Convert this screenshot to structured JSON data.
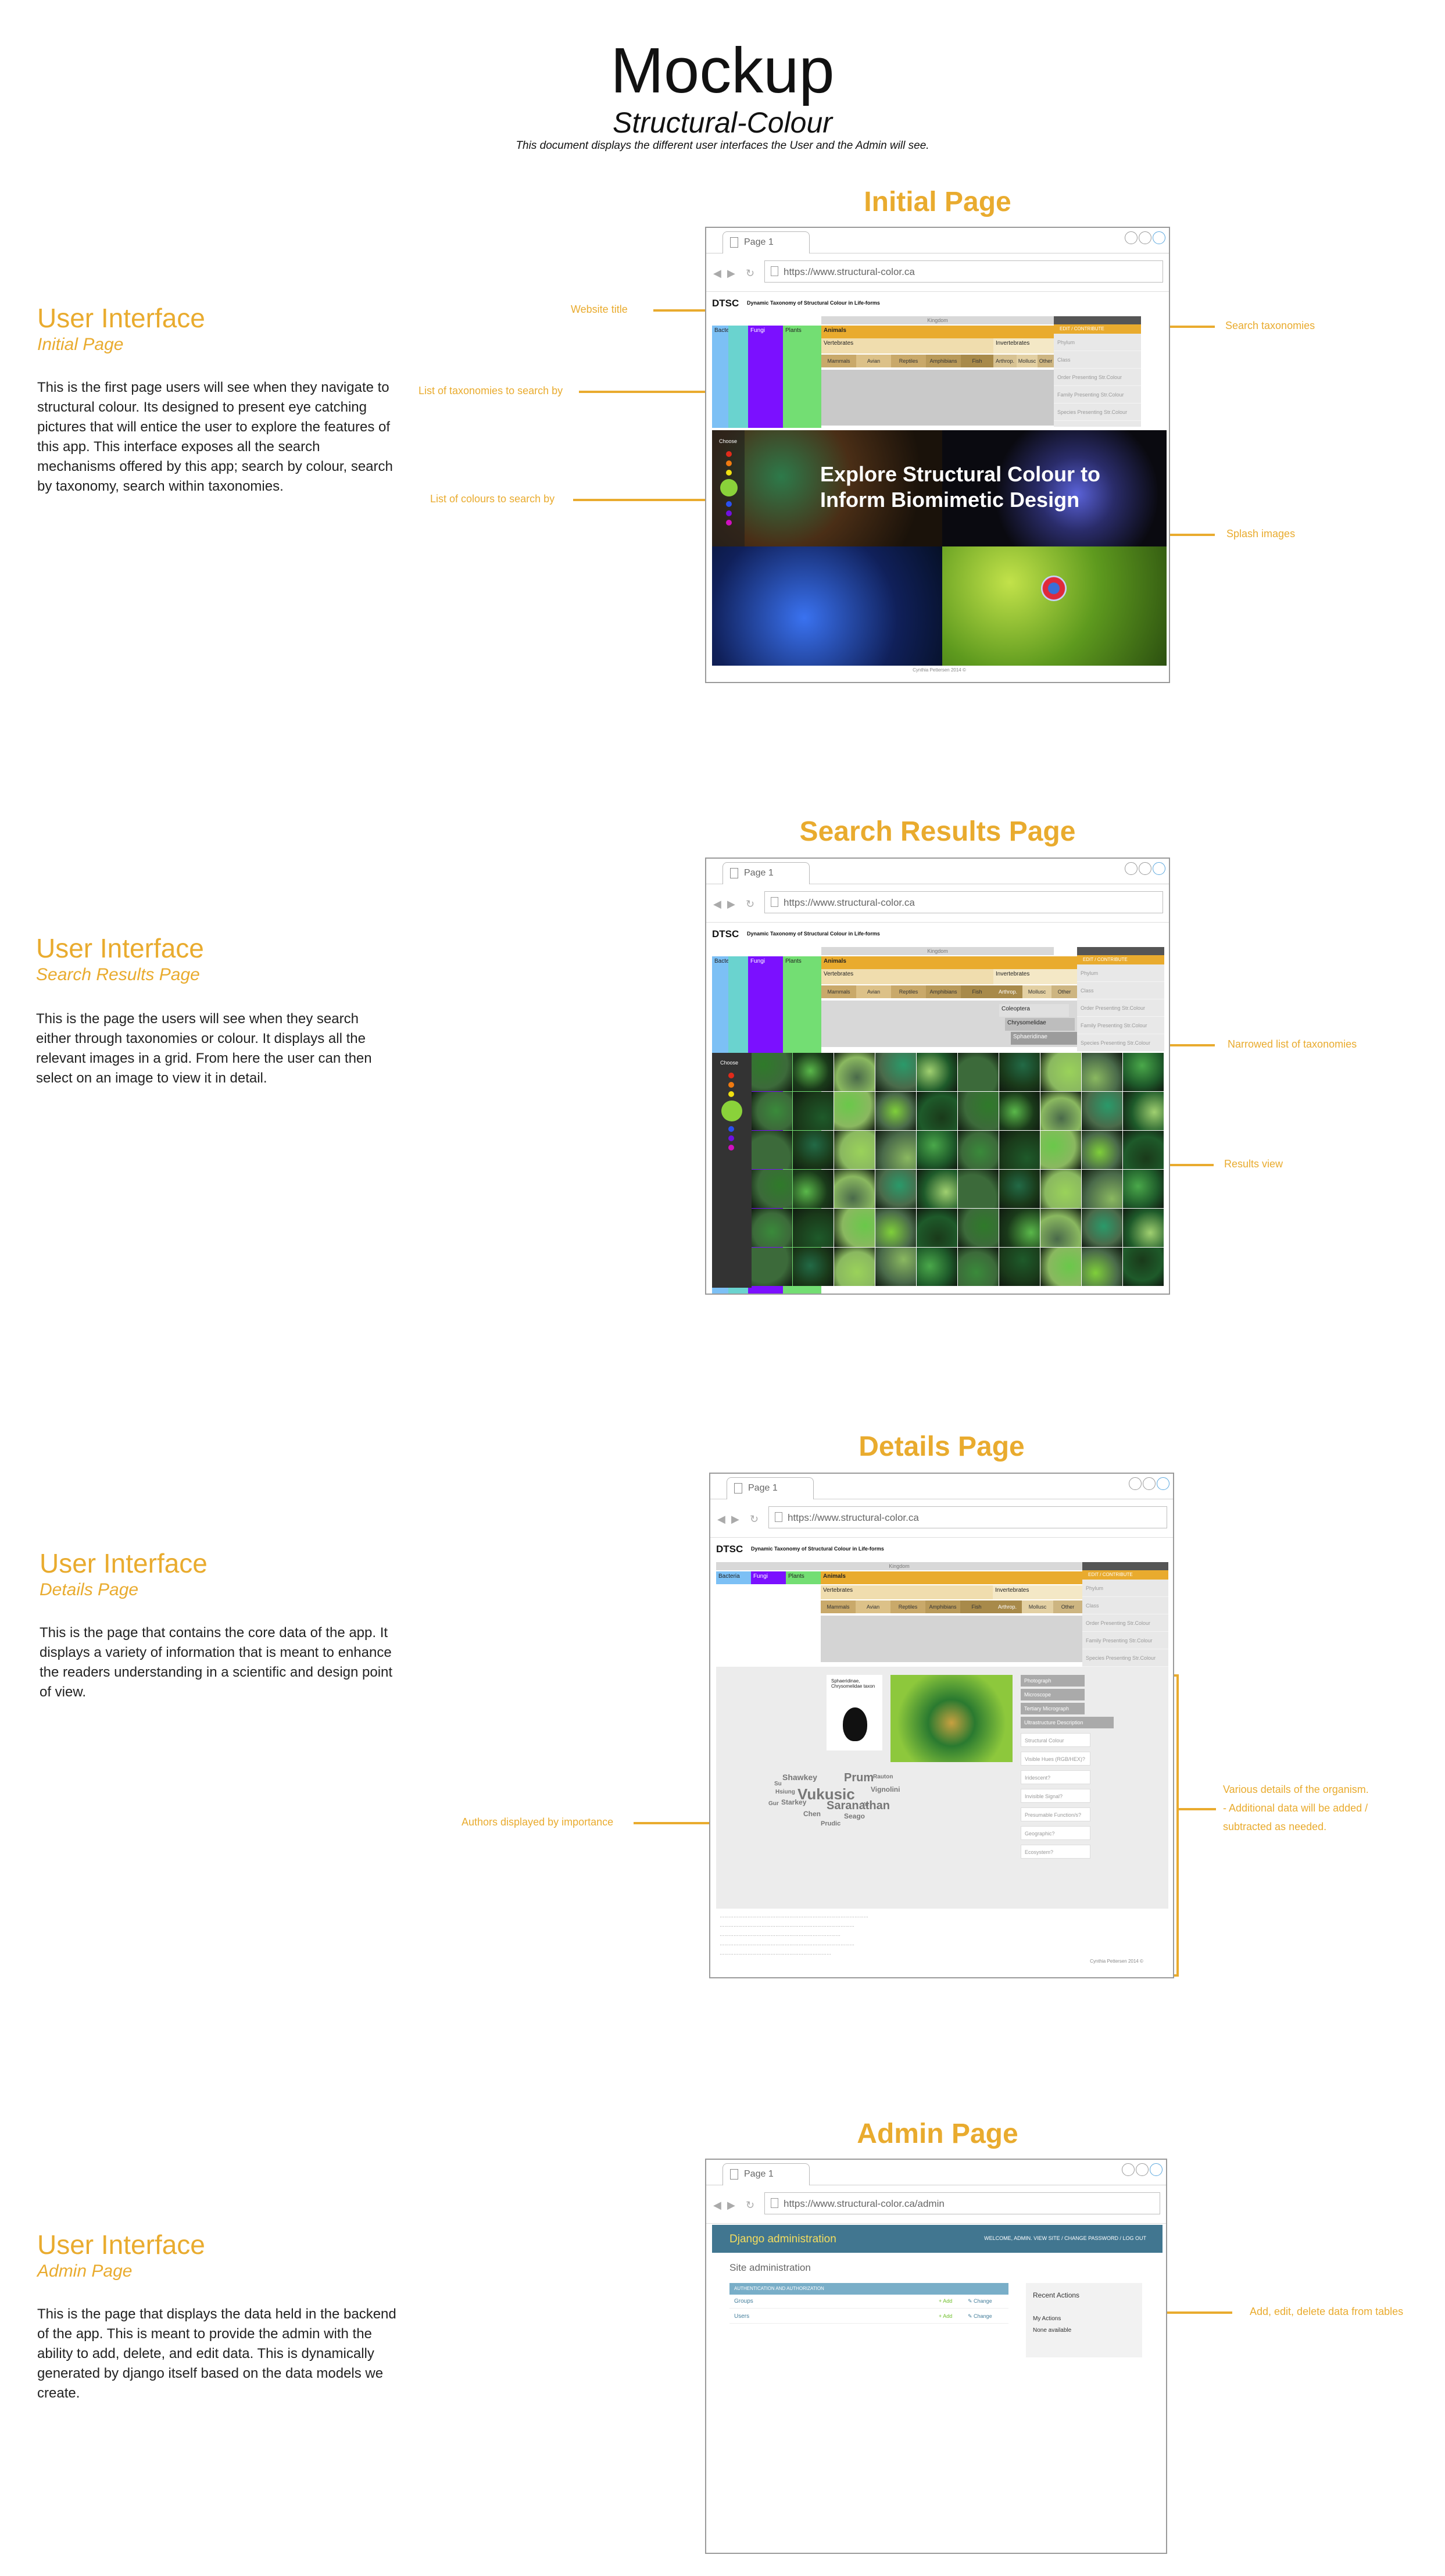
{
  "header": {
    "title": "Mockup",
    "subtitle": "Structural-Colour",
    "description": "This document displays the different user interfaces the User and the Admin will see."
  },
  "browser": {
    "tab_label": "Page 1",
    "url_public": "https://www.structural-color.ca",
    "url_admin": "https://www.structural-color.ca/admin"
  },
  "site": {
    "logo": "DTSC",
    "name": "Dynamic Taxonomy of Structural Colour in Life-forms",
    "kingdom_label": "Kingdom",
    "kingdoms": [
      "Bacteria",
      "Fungi",
      "Plants"
    ],
    "animals": "Animals",
    "vertebrates": "Vertebrates",
    "invertebrates": "Invertebrates",
    "vertebrate_classes": [
      "Mammals",
      "Avian",
      "Reptiles",
      "Amphibians",
      "Fish"
    ],
    "invertebrate_classes": [
      "Arthrop.",
      "Mollusc",
      "Other"
    ],
    "edit_contribute": "EDIT / CONTRIBUTE",
    "rank_list": [
      "Phylum",
      "Class",
      "Order Presenting Str.Colour",
      "Family Presenting Str.Colour",
      "Species Presenting Str.Colour"
    ],
    "choose_label": "Choose",
    "splash_text": "Explore Structural Colour to Inform Biomimetic Design",
    "footer_credit": "Cynthia Pettersen 2014 ©",
    "coleoptera": "Coleoptera",
    "chrysomelidae": "Chrysomelidae",
    "sphaeridinae": "Sphaeridinae"
  },
  "sections": [
    {
      "page_title": "Initial Page",
      "ui_heading": "User Interface",
      "ui_subheading": "Initial Page",
      "description": "This is the first page users will see when they navigate to structural colour. Its designed to present eye catching pictures that will entice the user to explore the features of this app.  This interface exposes all the search mechanisms offered by this app; search by colour, search by taxonomy, search within taxonomies.",
      "annotations": {
        "website_title": "Website title",
        "list_taxonomies": "List of taxonomies to search by",
        "list_colours": "List of colours to search by",
        "search_taxonomies": "Search taxonomies",
        "splash_images": "Splash images"
      }
    },
    {
      "page_title": "Search Results Page",
      "ui_heading": "User Interface",
      "ui_subheading": "Search Results Page",
      "description": "This is the page the users will see when they search either through taxonomies or colour.  It displays all the relevant images in a grid.  From here the user can then select on an image to view it in detail.",
      "annotations": {
        "narrowed_list": "Narrowed list of taxonomies",
        "results_view": "Results view"
      }
    },
    {
      "page_title": "Details Page",
      "ui_heading": "User Interface",
      "ui_subheading": "Details Page",
      "description": "This is the page that contains the core data of the app.  It displays a variety of information that is meant to enhance the readers understanding in a scientific and design point of view.",
      "annotations": {
        "authors": "Authors displayed by importance",
        "various_details_1": "Various details of the organism.",
        "various_details_2": "- Additional data will be added /",
        "various_details_3": "subtracted as needed."
      },
      "specimen_name": "Sphaeridinae, Chrysomelidae taxon",
      "details_items": [
        "Photograph",
        "Microscope",
        "Tertiary Micrograph",
        "Ultrastructure Description",
        "Structural Colour Mechanism?",
        "Visible Hues (RGB/HEX)?",
        "Iridescent?",
        "Invisible Signal?",
        "Presumable Function/s?",
        "Geographic?",
        "Ecosystem?"
      ],
      "authors": [
        "Vukusic",
        "Prum",
        "Saranathan",
        "Shawkey",
        "Vignolini",
        "Starkey",
        "Chen",
        "Seago",
        "Prudic",
        "Su",
        "Hsiung",
        "Rauton",
        "Yu",
        "Gur"
      ]
    },
    {
      "page_title": "Admin Page",
      "ui_heading": "User Interface",
      "ui_subheading": "Admin Page",
      "description": "This is the page that displays the data held in the backend of the app.  This is meant to provide the admin with the ability to add, delete, and edit data.  This is dynamically generated by django itself based on the data models we create.",
      "annotations": {
        "add_edit": "Add, edit, delete data from tables"
      }
    }
  ],
  "admin": {
    "brand": "Django administration",
    "user_tools": "WELCOME, ADMIN. VIEW SITE / CHANGE PASSWORD / LOG OUT",
    "site_admin": "Site administration",
    "module_caption": "AUTHENTICATION AND AUTHORIZATION",
    "rows": [
      {
        "name": "Groups",
        "add": "+ Add",
        "change": "✎ Change"
      },
      {
        "name": "Users",
        "add": "+ Add",
        "change": "✎ Change"
      }
    ],
    "recent_actions": "Recent Actions",
    "my_actions": "My Actions",
    "none_available": "None available"
  }
}
